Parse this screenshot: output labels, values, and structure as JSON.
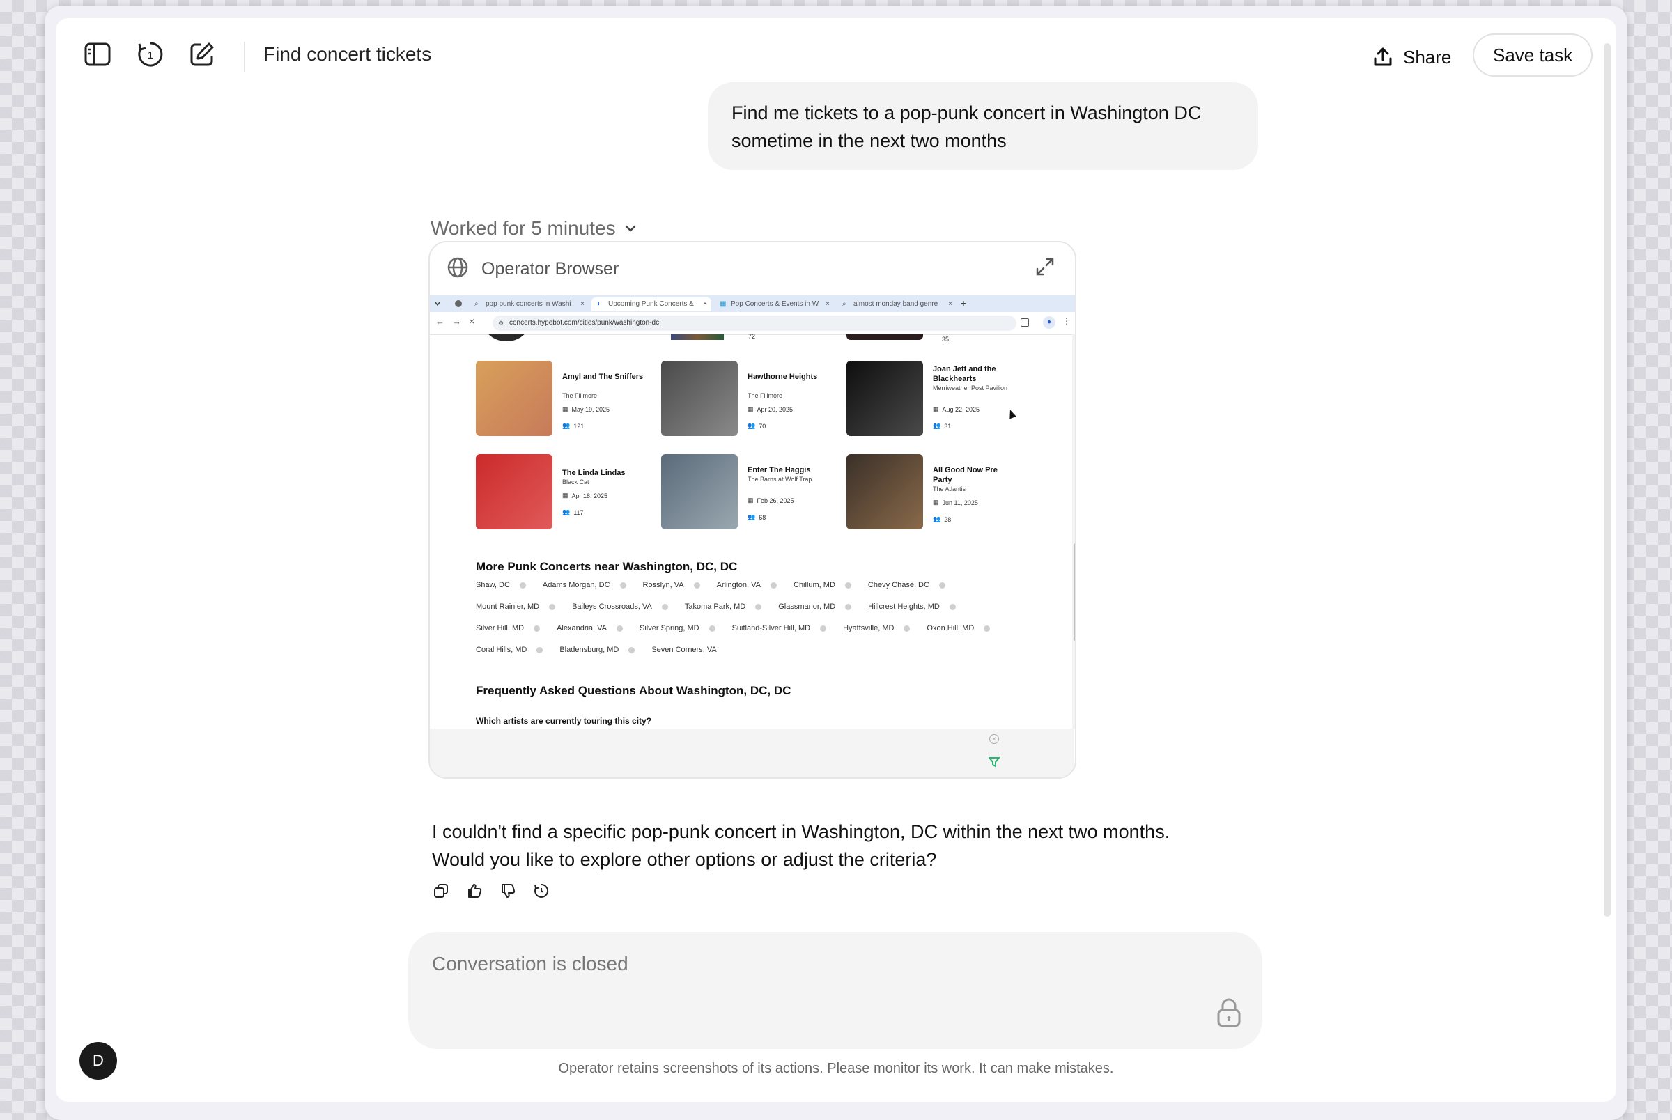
{
  "header": {
    "title": "Find concert tickets",
    "share_label": "Share",
    "save_label": "Save task",
    "history_badge": "1"
  },
  "conversation": {
    "user_message": "Find me tickets to a pop-punk concert in Washington DC sometime in the next two months",
    "worked_for": "Worked for 5 minutes",
    "assistant_reply": "I couldn't find a specific pop-punk concert in Washington, DC within the next two months. Would you like to explore other options or adjust the criteria?"
  },
  "browser_card": {
    "title": "Operator Browser",
    "tabs": [
      "pop punk concerts in Washi",
      "Upcoming Punk Concerts &",
      "Pop Concerts & Events in W",
      "almost monday band genre"
    ],
    "new_tab": "+",
    "url": "concerts.hypebot.com/cities/punk/washington-dc",
    "top_partial_counts": [
      "72",
      "35"
    ],
    "concerts": [
      {
        "name": "Amyl and The Sniffers",
        "venue": "The Fillmore",
        "date": "May 19, 2025",
        "fans": "121"
      },
      {
        "name": "Hawthorne Heights",
        "venue": "The Fillmore",
        "date": "Apr 20, 2025",
        "fans": "70"
      },
      {
        "name": "Joan Jett and the Blackhearts",
        "venue": "Merriweather Post Pavilion",
        "date": "Aug 22, 2025",
        "fans": "31"
      },
      {
        "name": "The Linda Lindas",
        "venue": "Black Cat",
        "date": "Apr 18, 2025",
        "fans": "117"
      },
      {
        "name": "Enter The Haggis",
        "venue": "The Barns at Wolf Trap",
        "date": "Feb 26, 2025",
        "fans": "68"
      },
      {
        "name": "All Good Now Pre Party",
        "venue": "The Atlantis",
        "date": "Jun 11, 2025",
        "fans": "28"
      }
    ],
    "more_heading": "More Punk Concerts near Washington, DC, DC",
    "locations": [
      [
        "Shaw, DC",
        "Adams Morgan, DC",
        "Rosslyn, VA",
        "Arlington, VA",
        "Chillum, MD",
        "Chevy Chase, DC"
      ],
      [
        "Mount Rainier, MD",
        "Baileys Crossroads, VA",
        "Takoma Park, MD",
        "Glassmanor, MD",
        "Hillcrest Heights, MD"
      ],
      [
        "Silver Hill, MD",
        "Alexandria, VA",
        "Silver Spring, MD",
        "Suitland-Silver Hill, MD",
        "Hyattsville, MD",
        "Oxon Hill, MD"
      ],
      [
        "Coral Hills, MD",
        "Bladensburg, MD",
        "Seven Corners, VA"
      ]
    ],
    "faq_heading": "Frequently Asked Questions About Washington, DC, DC",
    "faq_question": "Which artists are currently touring this city?"
  },
  "composer": {
    "placeholder": "Conversation is closed"
  },
  "disclaimer": "Operator retains screenshots of its actions. Please monitor its work. It can make mistakes.",
  "user": {
    "initial": "D"
  },
  "colors": {
    "accent_green": "#2bb673",
    "bubble_bg": "#f3f3f3",
    "tab_strip": "#dfe9f8"
  }
}
